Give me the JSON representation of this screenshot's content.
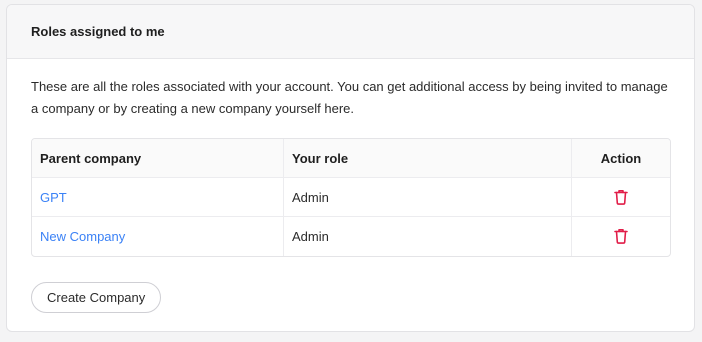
{
  "card": {
    "title": "Roles assigned to me",
    "description": "These are all the roles associated with your account. You can get additional access by being invited to manage a company or by creating a new company yourself here."
  },
  "table": {
    "headers": {
      "company": "Parent company",
      "role": "Your role",
      "action": "Action"
    },
    "rows": [
      {
        "company": "GPT",
        "role": "Admin",
        "action_icon": "trash-icon"
      },
      {
        "company": "New Company",
        "role": "Admin",
        "action_icon": "trash-icon"
      }
    ]
  },
  "create_button_label": "Create Company",
  "colors": {
    "link": "#3b82f6",
    "delete": "#e11d48"
  }
}
